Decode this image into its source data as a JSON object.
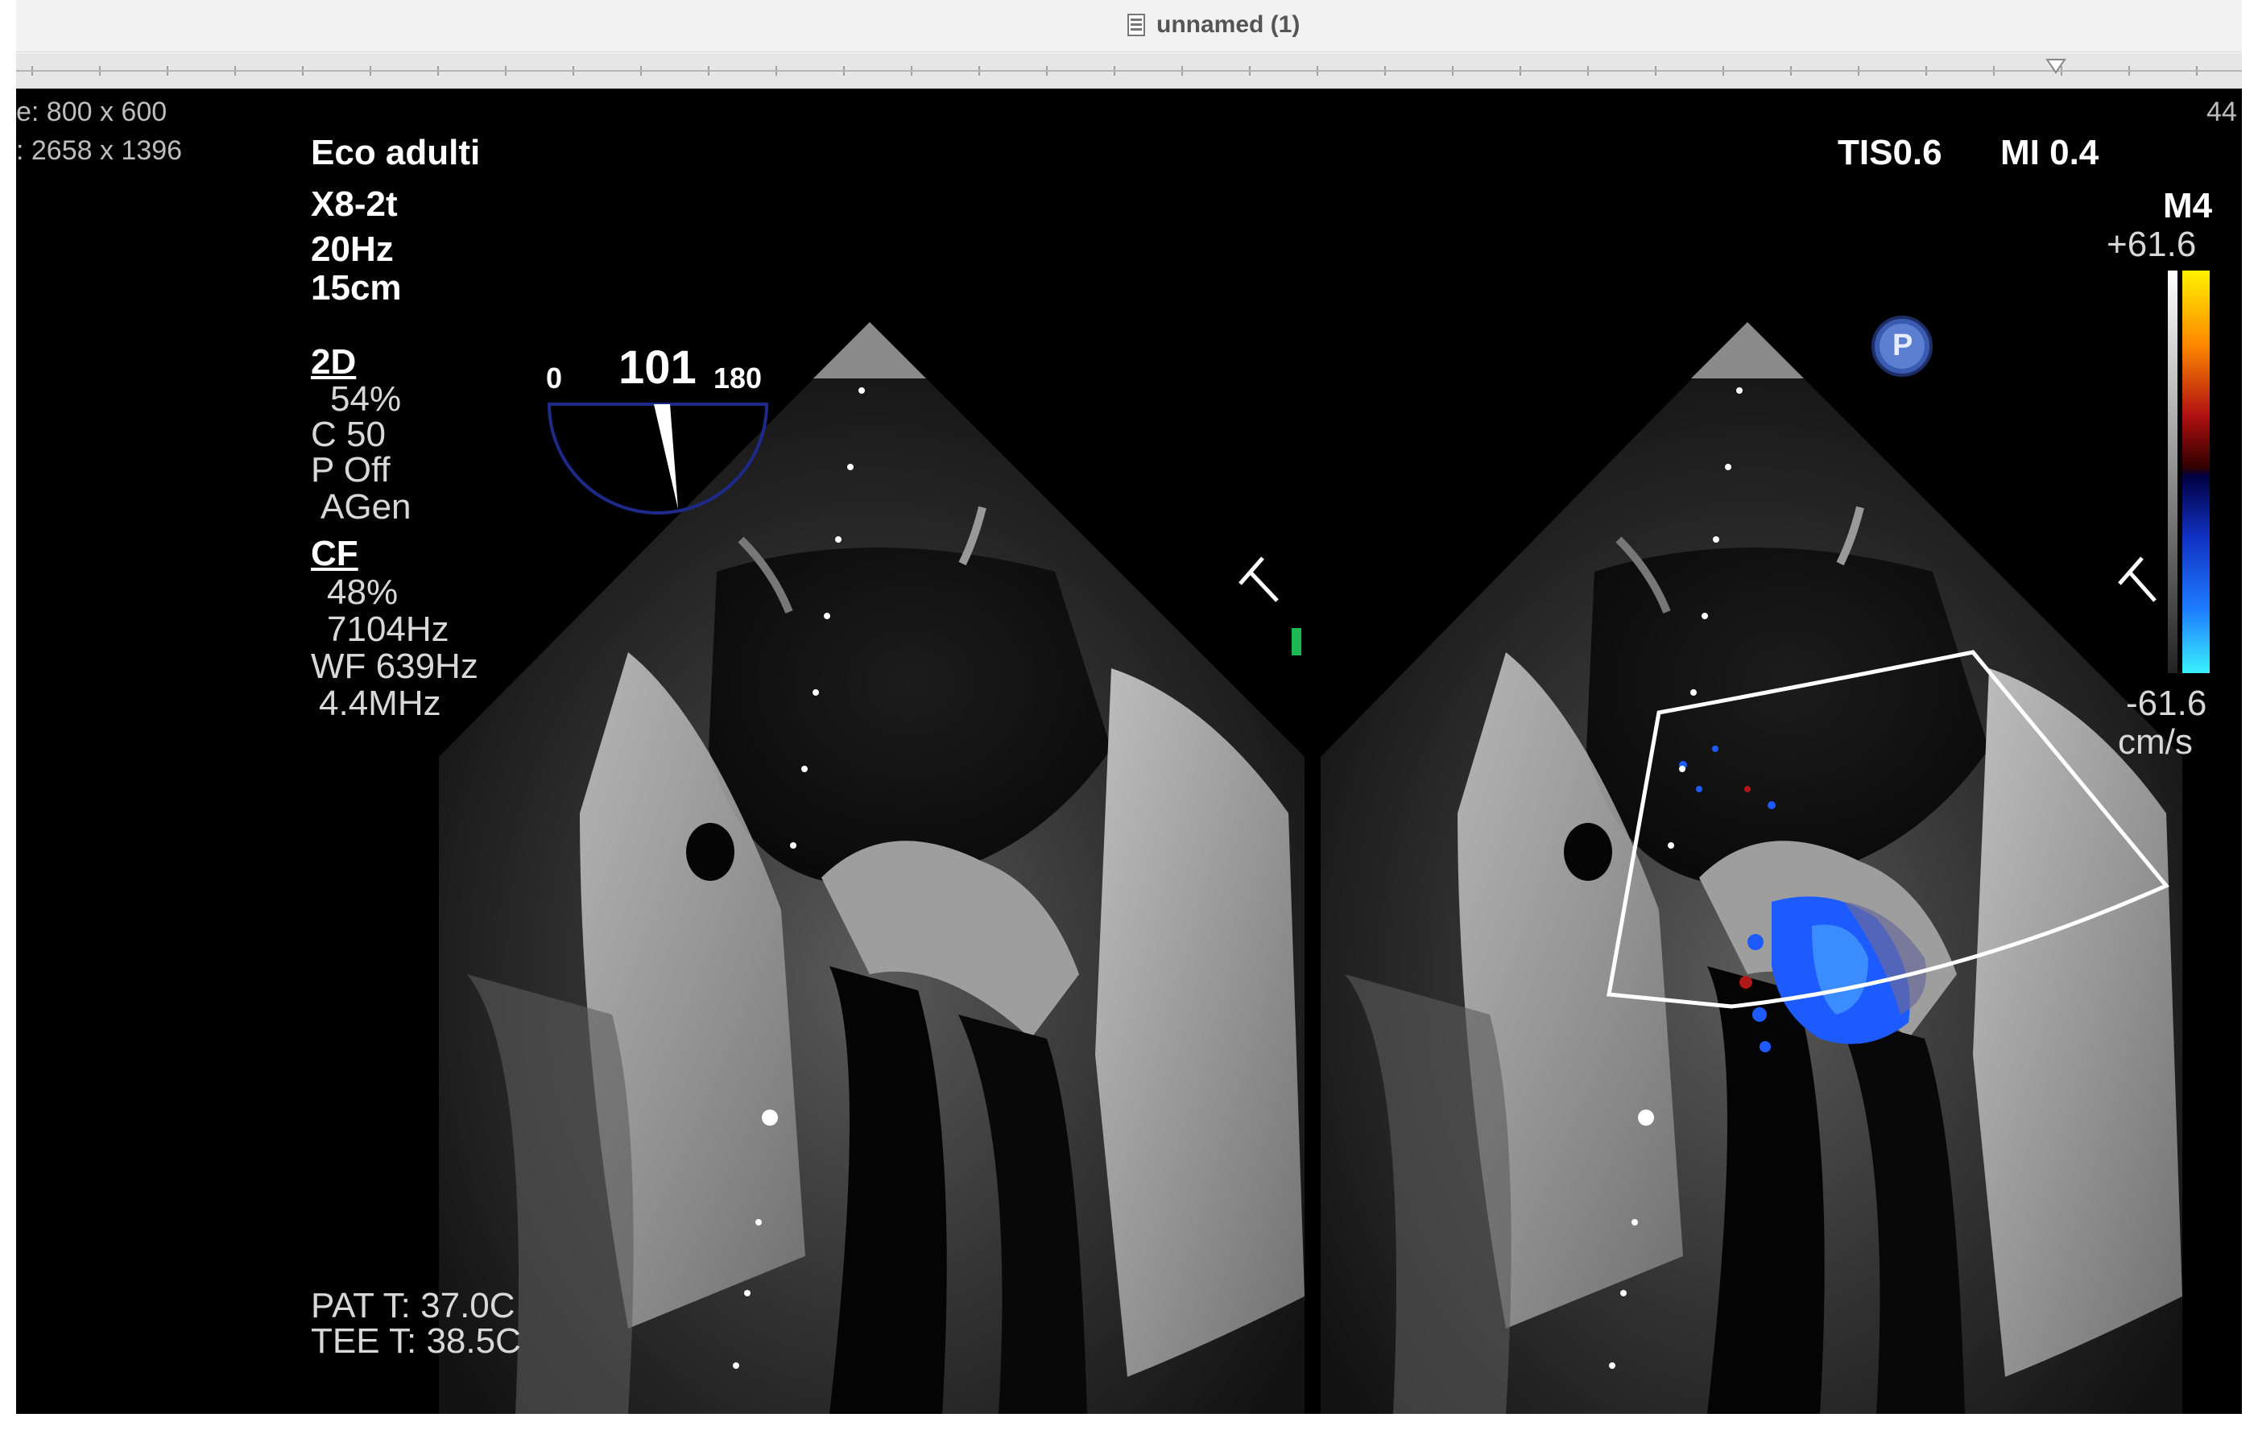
{
  "window": {
    "title": "unnamed (1)",
    "image_size_label": "e: 800 x 600",
    "screen_size_label": ": 2658 x 1396",
    "edge_number": "44"
  },
  "echo": {
    "preset": "Eco adulti",
    "probe": "X8-2t",
    "frame_rate": "20Hz",
    "depth": "15cm",
    "twod": {
      "label": "2D",
      "gain": "54%",
      "compression": "C 50",
      "persistence": "P Off",
      "mode": "AGen"
    },
    "cf": {
      "label": "CF",
      "gain": "48%",
      "prf": "7104Hz",
      "wall_filter": "WF 639Hz",
      "frequency": "4.4MHz"
    },
    "angle": {
      "min": "0",
      "value": "101",
      "max": "180"
    },
    "tis": "TIS0.6",
    "mi": "MI 0.4",
    "mode_indicator": "M4",
    "velocity_max": "+61.6",
    "velocity_min": "-61.6",
    "velocity_unit": "cm/s",
    "p_marker": "P",
    "pat_temp": "PAT T: 37.0C",
    "tee_temp": "TEE T: 38.5C"
  },
  "colors": {
    "background": "#000000",
    "text": "#ffffff",
    "angle_dial": "#1e2a8a",
    "doppler_blue": "#1e5bff",
    "doppler_red": "#b01818"
  }
}
